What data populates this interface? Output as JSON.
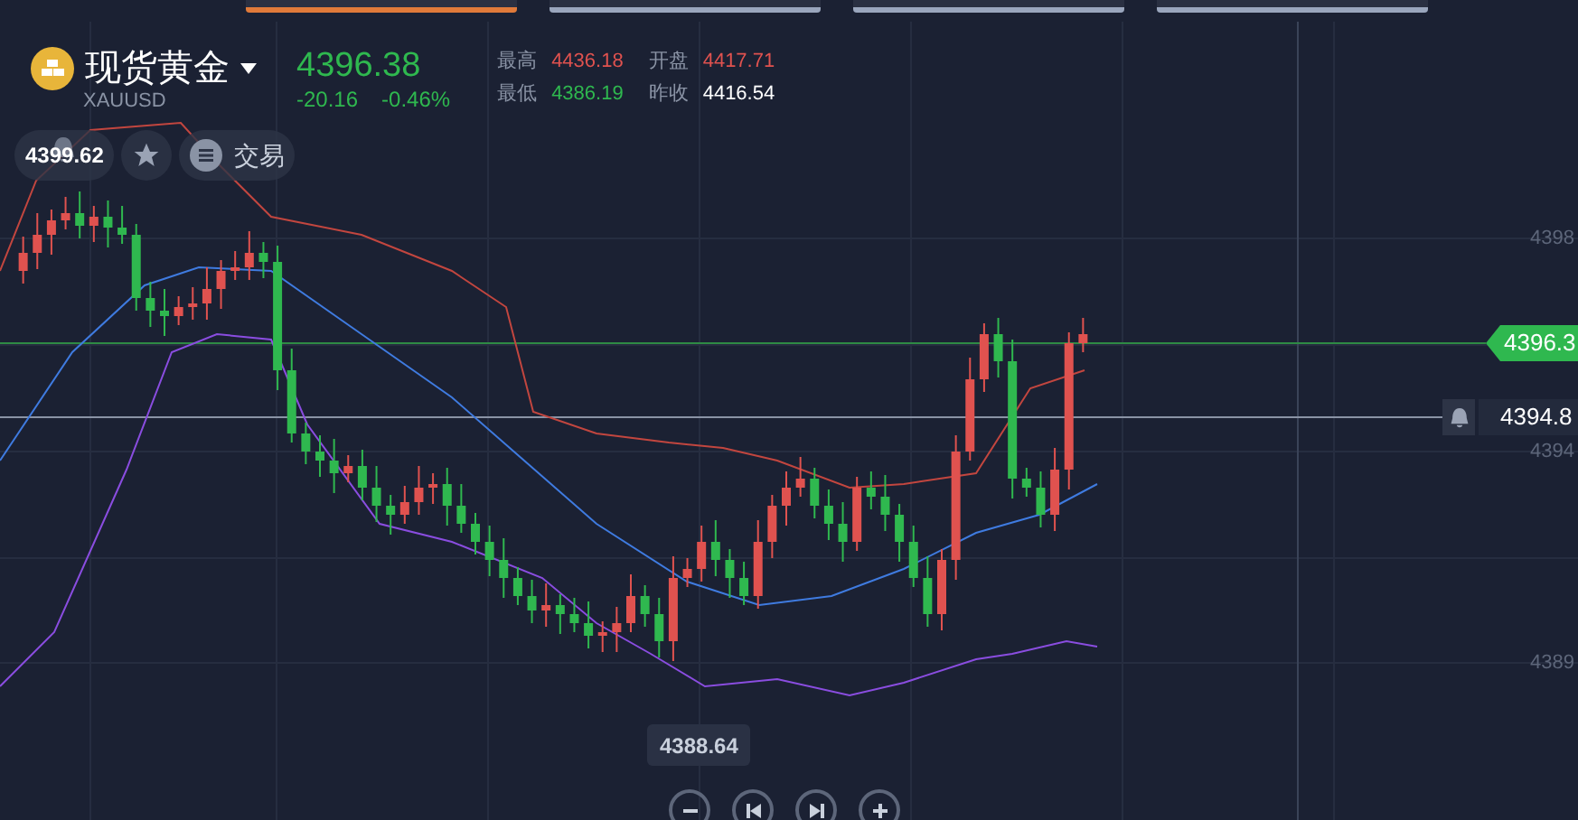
{
  "top_tabs": [
    {
      "selected": true
    },
    {
      "selected": false
    },
    {
      "selected": false
    },
    {
      "selected": false
    }
  ],
  "instrument": {
    "name": "现货黄金",
    "symbol": "XAUUSD"
  },
  "quote": {
    "price": "4396.38",
    "change": "-20.16",
    "change_percent": "-0.46%"
  },
  "stats": [
    {
      "label": "最高",
      "value": "4436.18",
      "color": "#e0524f"
    },
    {
      "label": "开盘",
      "value": "4417.71",
      "color": "#e0524f"
    },
    {
      "label": "最低",
      "value": "4386.19",
      "color": "#2fb84f"
    },
    {
      "label": "昨收",
      "value": "4416.54",
      "color": "#ffffff"
    }
  ],
  "actions": [
    {
      "kind": "alert",
      "label": "4399.62"
    },
    {
      "kind": "favorite"
    },
    {
      "kind": "trade",
      "label": "交易"
    }
  ],
  "price_axis": [
    "4398",
    "4394",
    "4389"
  ],
  "current_price_tag": "4396.3",
  "alert_line": {
    "value": "4394.8"
  },
  "low_marker": "4388.64",
  "zoom_controls": [
    {
      "kind": "zoom-out"
    },
    {
      "kind": "previous"
    },
    {
      "kind": "next"
    },
    {
      "kind": "zoom-in"
    }
  ]
}
